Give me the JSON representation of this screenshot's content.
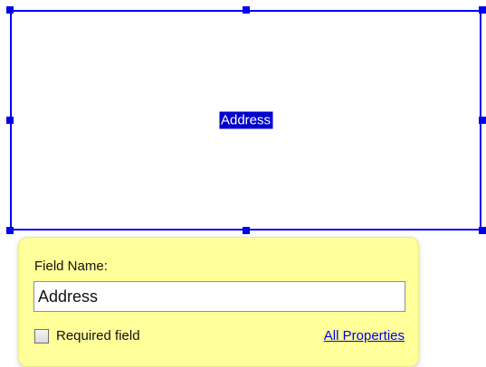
{
  "form_field": {
    "label": "Address"
  },
  "field_popup": {
    "title": "Field Name:",
    "name_value": "Address",
    "required_label": "Required field",
    "required_checked": false,
    "all_properties_link": "All Properties"
  },
  "colors": {
    "selection_border": "#0000ee",
    "popup_background": "#ffff99",
    "link": "#0000ee"
  }
}
